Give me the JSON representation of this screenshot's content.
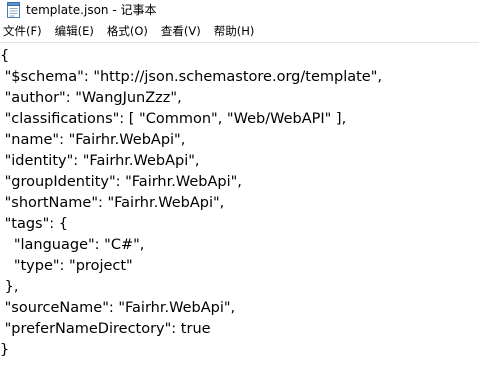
{
  "window": {
    "title": "template.json - 记事本",
    "icon": "notepad-icon"
  },
  "menu": [
    {
      "label": "文件(F)"
    },
    {
      "label": "编辑(E)"
    },
    {
      "label": "格式(O)"
    },
    {
      "label": "查看(V)"
    },
    {
      "label": "帮助(H)"
    }
  ],
  "editor": {
    "lines": [
      "{",
      " \"$schema\": \"http://json.schemastore.org/template\",",
      " \"author\": \"WangJunZzz\",",
      " \"classifications\": [ \"Common\", \"Web/WebAPI\" ],",
      " \"name\": \"Fairhr.WebApi\",",
      " \"identity\": \"Fairhr.WebApi\",",
      " \"groupIdentity\": \"Fairhr.WebApi\",",
      " \"shortName\": \"Fairhr.WebApi\",",
      " \"tags\": {",
      "   \"language\": \"C#\",",
      "   \"type\": \"project\"",
      " },",
      " \"sourceName\": \"Fairhr.WebApi\",",
      " \"preferNameDirectory\": true",
      "}"
    ]
  }
}
